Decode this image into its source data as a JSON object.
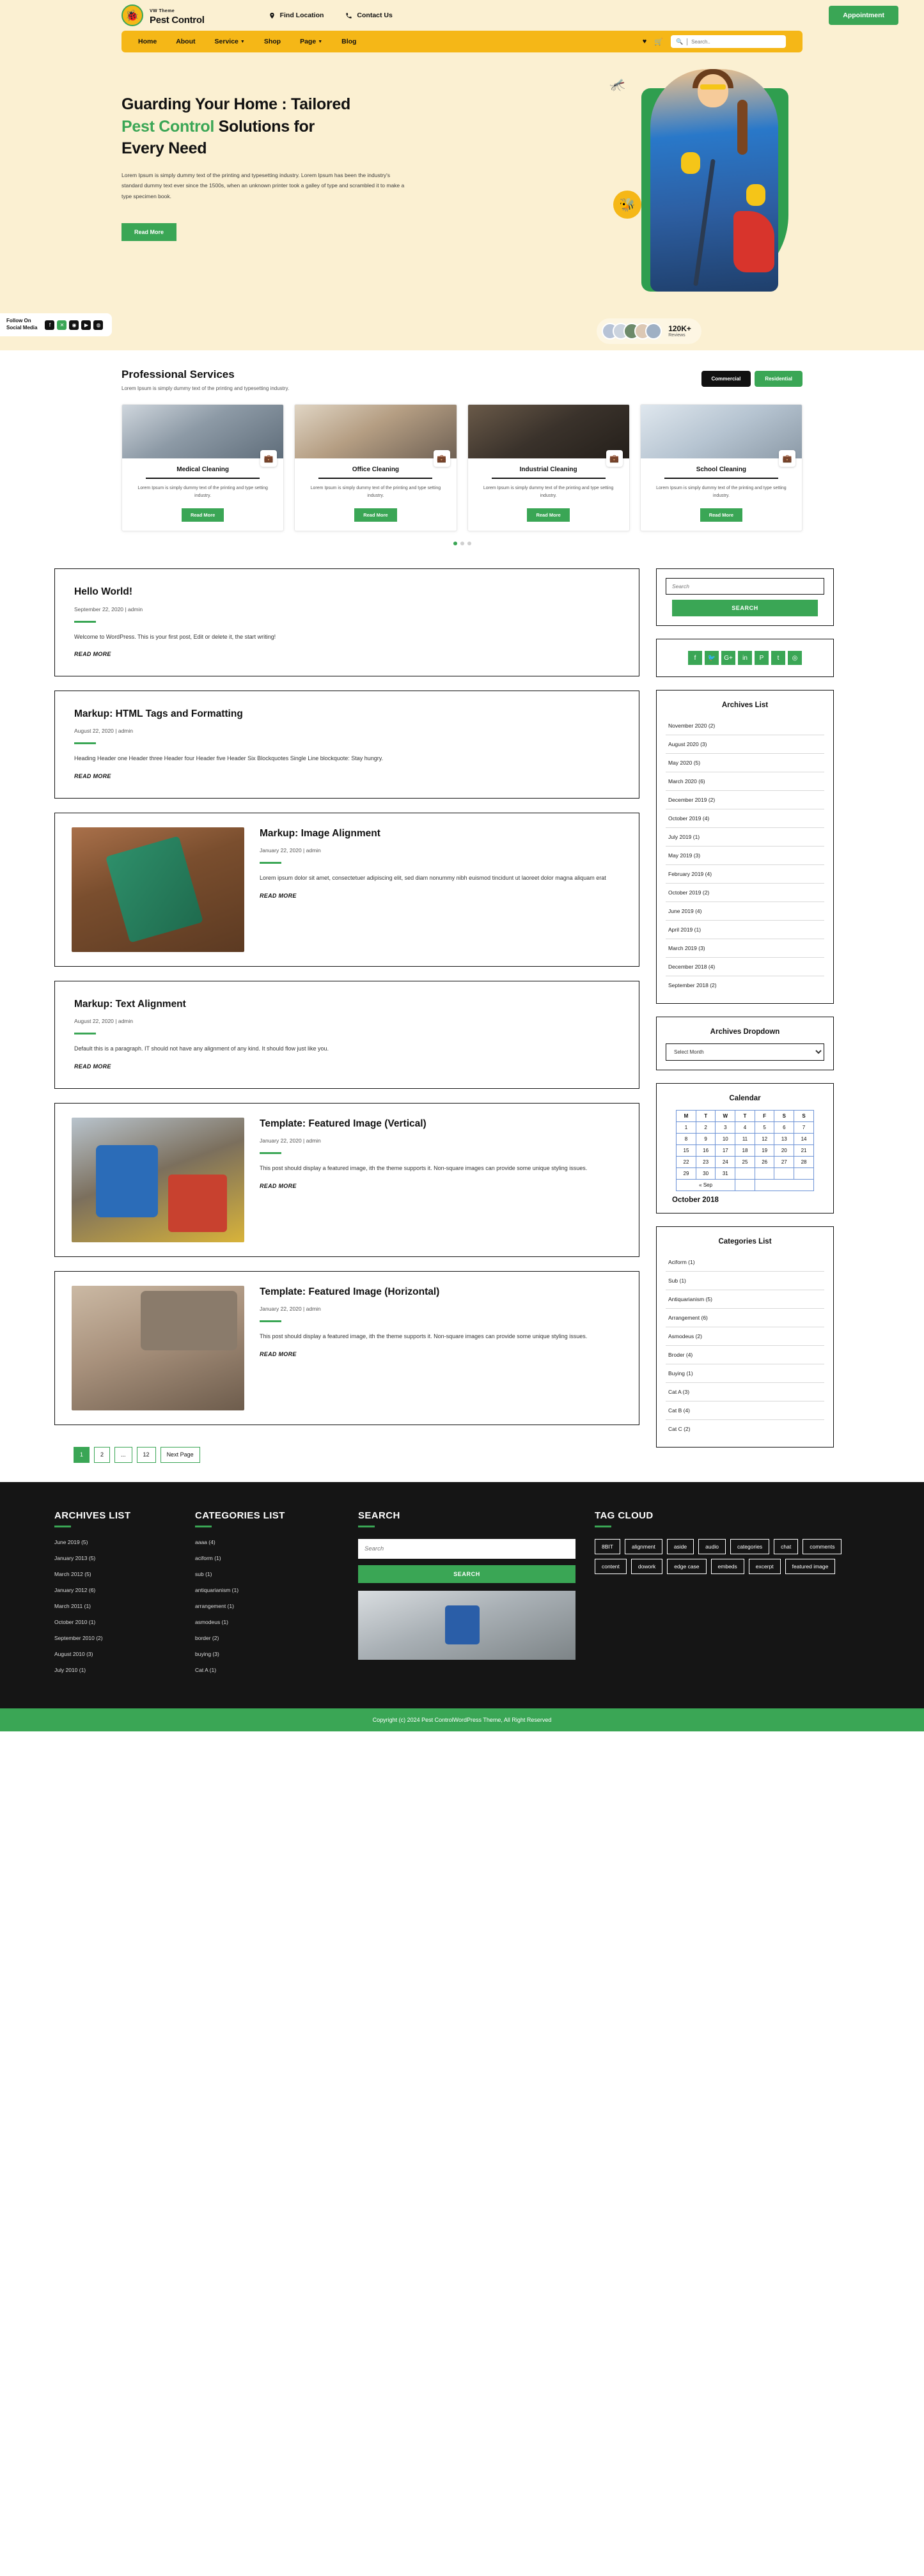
{
  "header": {
    "brand_sub": "VW Theme",
    "brand_name": "Pest Control",
    "logo_icon": "bug-icon",
    "find_location": "Find Location",
    "contact_us": "Contact Us",
    "appointment": "Appointment"
  },
  "nav": {
    "items": [
      {
        "label": "Home",
        "has_caret": false
      },
      {
        "label": "About",
        "has_caret": false
      },
      {
        "label": "Service",
        "has_caret": true
      },
      {
        "label": "Shop",
        "has_caret": false
      },
      {
        "label": "Page",
        "has_caret": true
      },
      {
        "label": "Blog",
        "has_caret": false
      }
    ],
    "wishlist_icon": "heart-icon",
    "cart_icon": "cart-icon",
    "search_placeholder": "Search.."
  },
  "hero": {
    "title_line1": "Guarding Your Home : Tailored",
    "title_green": "Pest Control",
    "title_line2_rest": " Solutions for",
    "title_line3": "Every Need",
    "paragraph": "Lorem Ipsum is simply dummy text of the printing and typesetting industry. Lorem Ipsum has been the industry's standard dummy text ever since the 1500s, when an unknown printer took a galley of type and scrambled it to make a type specimen book.",
    "button": "Read More",
    "reviews_count": "120K+",
    "reviews_label": "Reviews",
    "follow_label_line1": "Follow On",
    "follow_label_line2": "Social Media",
    "social": [
      {
        "name": "facebook-icon",
        "glyph": "f",
        "accent": false
      },
      {
        "name": "x-twitter-icon",
        "glyph": "✕",
        "accent": true
      },
      {
        "name": "instagram-icon",
        "glyph": "◉",
        "accent": false
      },
      {
        "name": "youtube-icon",
        "glyph": "▶",
        "accent": false
      },
      {
        "name": "dribbble-icon",
        "glyph": "◍",
        "accent": false
      }
    ]
  },
  "services": {
    "title": "Professional Services",
    "subtitle": "Lorem Ipsum is simply dummy text of the printing and typesetting industry.",
    "tab_commercial": "Commercial",
    "tab_residential": "Residential",
    "cards": [
      {
        "title": "Medical Cleaning",
        "text": "Lorem Ipsum is simply dummy text of the printing and type setting industry.",
        "button": "Read More",
        "icon": "briefcase-icon"
      },
      {
        "title": "Office Cleaning",
        "text": "Lorem Ipsum is simply dummy text of the printing and type setting industry.",
        "button": "Read More",
        "icon": "briefcase-icon"
      },
      {
        "title": "Industrial Cleaning",
        "text": "Lorem Ipsum is simply dummy text of the printing and type setting industry.",
        "button": "Read More",
        "icon": "briefcase-icon"
      },
      {
        "title": "School Cleaning",
        "text": "Lorem Ipsum is simply dummy text of the printing and type setting industry.",
        "button": "Read More",
        "icon": "briefcase-icon"
      }
    ]
  },
  "posts": [
    {
      "title": "Hello World!",
      "meta": "September 22, 2020 | admin",
      "text": "Welcome to WordPress. This is your first post, Edit or delete it, the start writing!",
      "read_more": "READ MORE",
      "has_image": false
    },
    {
      "title": "Markup: HTML Tags and Formatting",
      "meta": "August 22, 2020 | admin",
      "text": "Heading Header one Header three Header four Header five Header Six Blockquotes Single Line blockquote: Stay hungry.",
      "read_more": "READ MORE",
      "has_image": false
    },
    {
      "title": "Markup: Image Alignment",
      "meta": "January 22, 2020 | admin",
      "text": "Lorem ipsum dolor sit amet, consectetuer adipiscing elit, sed diam nonummy nibh euismod tincidunt ut laoreet dolor magna aliquam erat",
      "read_more": "READ MORE",
      "has_image": true
    },
    {
      "title": "Markup: Text Alignment",
      "meta": "August 22, 2020 | admin",
      "text": "Default this is a paragraph. IT should not have any alignment of any kind. It should flow just like you.",
      "read_more": "READ MORE",
      "has_image": false
    },
    {
      "title": "Template: Featured Image (Vertical)",
      "meta": "January 22, 2020 | admin",
      "text": "This post should display a featured image, ith the theme supports it. Non-square images can provide some unique styling issues.",
      "read_more": "READ MORE",
      "has_image": true
    },
    {
      "title": "Template: Featured Image (Horizontal)",
      "meta": "January 22, 2020 | admin",
      "text": "This post should display a featured image, ith the theme supports it. Non-square images can provide some unique styling issues.",
      "read_more": "READ MORE",
      "has_image": true
    }
  ],
  "pagination": [
    "1",
    "2",
    "...",
    "12",
    "Next Page"
  ],
  "sidebar": {
    "search": {
      "placeholder": "Search",
      "button": "SEARCH"
    },
    "social": [
      {
        "name": "facebook-icon",
        "glyph": "f"
      },
      {
        "name": "twitter-icon",
        "glyph": "🐦"
      },
      {
        "name": "google-plus-icon",
        "glyph": "G+"
      },
      {
        "name": "linkedin-icon",
        "glyph": "in"
      },
      {
        "name": "pinterest-icon",
        "glyph": "P"
      },
      {
        "name": "tumblr-icon",
        "glyph": "t"
      },
      {
        "name": "instagram-icon",
        "glyph": "◎"
      }
    ],
    "archives_title": "Archives List",
    "archives": [
      "November 2020 (2)",
      "August 2020 (3)",
      "May 2020 (5)",
      "March 2020 (6)",
      "December 2019 (2)",
      "October 2019 (4)",
      "July 2019 (1)",
      "May 2019 (3)",
      "February 2019 (4)",
      "October 2019 (2)",
      "June 2019 (4)",
      "April 2019 (1)",
      "March 2019 (3)",
      "December 2018 (4)",
      "September 2018 (2)"
    ],
    "dropdown_title": "Archives Dropdown",
    "dropdown_selected": "Select Month",
    "calendar": {
      "title": "Calendar",
      "weekdays": [
        "M",
        "T",
        "W",
        "T",
        "F",
        "S",
        "S"
      ],
      "weeks": [
        [
          "1",
          "2",
          "3",
          "4",
          "5",
          "6",
          "7"
        ],
        [
          "8",
          "9",
          "10",
          "11",
          "12",
          "13",
          "14"
        ],
        [
          "15",
          "16",
          "17",
          "18",
          "19",
          "20",
          "21"
        ],
        [
          "22",
          "23",
          "24",
          "25",
          "26",
          "27",
          "28"
        ],
        [
          "29",
          "30",
          "31",
          "",
          "",
          "",
          ""
        ]
      ],
      "prev": "« Sep",
      "month_label": "October 2018"
    },
    "categories_title": "Categories List",
    "categories": [
      "Aciform (1)",
      "Sub (1)",
      "Antiquarianism (5)",
      "Arrangement (6)",
      "Asmodeus (2)",
      "Broder (4)",
      "Buying (1)",
      "Cat A (3)",
      "Cat B (4)",
      "Cat C (2)"
    ]
  },
  "footer": {
    "archives_title": "ARCHIVES LIST",
    "archives": [
      "June 2019 (5)",
      "January  2013 (5)",
      "March 2012 (5)",
      "January  2012 (6)",
      "March  2011 (1)",
      "October 2010 (1)",
      "September 2010 (2)",
      "August 2010 (3)",
      "July 2010 (1)"
    ],
    "categories_title": "CATEGORIES LIST",
    "categories": [
      "aaaa (4)",
      "aciform (1)",
      "sub (1)",
      "antiquarianism (1)",
      "arrangement (1)",
      "asmodeus (1)",
      "border (2)",
      "buying (3)",
      "Cat A (1)"
    ],
    "search_title": "SEARCH",
    "search_placeholder": "Search",
    "search_button": "SEARCH",
    "tag_title": "TAG CLOUD",
    "tags": [
      "8BIT",
      "alignment",
      "aside",
      "audio",
      "categories",
      "chat",
      "comments",
      "content",
      "dowork",
      "edge case",
      "embeds",
      "excerpt",
      "featured image"
    ],
    "copyright": "Copyright (c) 2024 Pest ControlWordPress Theme, All Right Reserved"
  },
  "colors": {
    "accent_green": "#3aa655",
    "accent_yellow": "#f5b717",
    "hero_bg": "#fbf0d2",
    "footer_bg": "#151515"
  }
}
